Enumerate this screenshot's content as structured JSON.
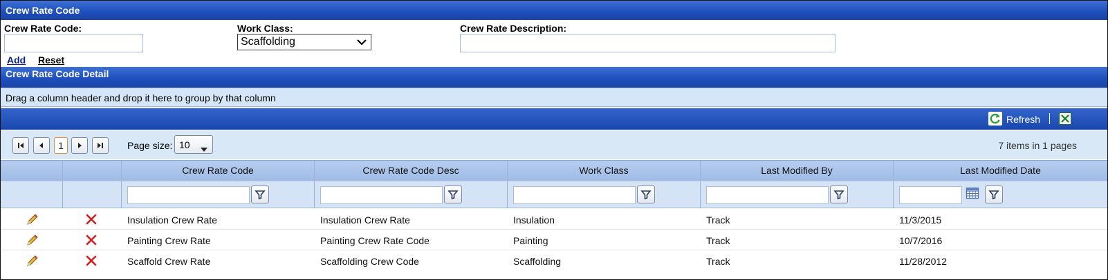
{
  "header": {
    "title": "Crew Rate Code"
  },
  "form": {
    "code_label": "Crew Rate Code:",
    "code_value": "",
    "work_class_label": "Work Class:",
    "work_class_value": "Scaffolding",
    "description_label": "Crew Rate Description:",
    "description_value": "",
    "add_label": "Add",
    "reset_label": "Reset"
  },
  "detail": {
    "title": "Crew Rate Code Detail",
    "group_hint": "Drag a column header and drop it here to group by that column",
    "refresh_label": "Refresh",
    "pager": {
      "current_page": "1",
      "page_size_label": "Page size:",
      "page_size_value": "10",
      "summary": "7 items in 1 pages"
    },
    "columns": [
      "Crew Rate Code",
      "Crew Rate Code Desc",
      "Work Class",
      "Last Modified By",
      "Last Modified Date"
    ],
    "rows": [
      {
        "code": "Insulation Crew Rate",
        "desc": "Insulation Crew Rate",
        "work_class": "Insulation",
        "modified_by": "Track",
        "modified_date": "11/3/2015"
      },
      {
        "code": "Painting Crew Rate",
        "desc": "Painting Crew Rate Code",
        "work_class": "Painting",
        "modified_by": "Track",
        "modified_date": "10/7/2016"
      },
      {
        "code": "Scaffold Crew Rate",
        "desc": "Scaffolding Crew Code",
        "work_class": "Scaffolding",
        "modified_by": "Track",
        "modified_date": "11/28/2012"
      }
    ]
  },
  "icons": {
    "edit": "pencil-icon",
    "delete": "delete-x-icon",
    "filter": "filter-funnel-icon",
    "calendar": "calendar-icon",
    "refresh": "refresh-icon",
    "export": "excel-export-icon"
  },
  "colors": {
    "header_blue": "#1f50bd",
    "pager_bg": "#d8e8f6",
    "delete_red": "#d42020"
  }
}
